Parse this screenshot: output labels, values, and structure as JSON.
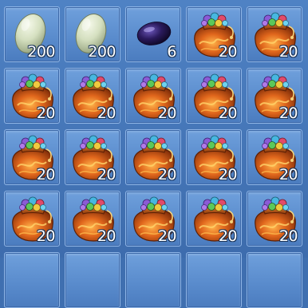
{
  "inventory": {
    "colors": {
      "panel": "#3f6fb0",
      "slot_top": "#6fa0dc",
      "slot_border": "#8fb5e6",
      "count_text": "#ffffff"
    },
    "slots": [
      {
        "item": "pale-green-egg",
        "count": "200"
      },
      {
        "item": "pale-green-egg",
        "count": "200"
      },
      {
        "item": "dark-purple-gem",
        "count": "6"
      },
      {
        "item": "treasure-bag",
        "count": "20"
      },
      {
        "item": "treasure-bag",
        "count": "20"
      },
      {
        "item": "treasure-bag",
        "count": "20"
      },
      {
        "item": "treasure-bag",
        "count": "20"
      },
      {
        "item": "treasure-bag",
        "count": "20"
      },
      {
        "item": "treasure-bag",
        "count": "20"
      },
      {
        "item": "treasure-bag",
        "count": "20"
      },
      {
        "item": "treasure-bag",
        "count": "20"
      },
      {
        "item": "treasure-bag",
        "count": "20"
      },
      {
        "item": "treasure-bag",
        "count": "20"
      },
      {
        "item": "treasure-bag",
        "count": "20"
      },
      {
        "item": "treasure-bag",
        "count": "20"
      },
      {
        "item": "treasure-bag",
        "count": "20"
      },
      {
        "item": "treasure-bag",
        "count": "20"
      },
      {
        "item": "treasure-bag",
        "count": "20"
      },
      {
        "item": "treasure-bag",
        "count": "20"
      },
      {
        "item": "treasure-bag",
        "count": "20"
      }
    ]
  }
}
